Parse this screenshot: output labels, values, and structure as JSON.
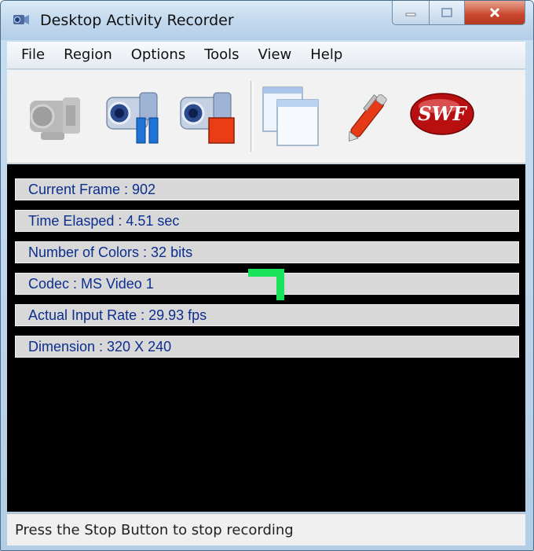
{
  "window": {
    "title": "Desktop Activity Recorder",
    "icon": "camcorder-app-icon",
    "controls": [
      "minimize-icon",
      "maximize-icon",
      "close-icon"
    ]
  },
  "menu": [
    "File",
    "Region",
    "Options",
    "Tools",
    "View",
    "Help"
  ],
  "toolbar": [
    {
      "name": "record-camera-button",
      "icon": "camera-disabled-icon",
      "enabled": false
    },
    {
      "name": "pause-button",
      "icon": "camera-pause-icon",
      "enabled": true
    },
    {
      "name": "stop-button",
      "icon": "camera-stop-icon",
      "enabled": true
    },
    {
      "name": "windows-button",
      "icon": "windows-stack-icon",
      "enabled": true
    },
    {
      "name": "edit-button",
      "icon": "pen-icon",
      "enabled": true
    },
    {
      "name": "swf-button",
      "icon": "swf-icon",
      "label": "SWF",
      "enabled": true
    }
  ],
  "info": [
    "Current Frame : 902",
    "Time Elasped  : 4.51 sec",
    "Number of Colors  : 32 bits",
    "Codec  : MS Video 1",
    "Actual Input Rate  : 29.93 fps",
    "Dimension  : 320 X 240"
  ],
  "status": "Press the Stop Button to stop recording",
  "colors": {
    "info_text": "#0c2f8e",
    "display_bg": "#000000",
    "marker": "#19e35a"
  }
}
